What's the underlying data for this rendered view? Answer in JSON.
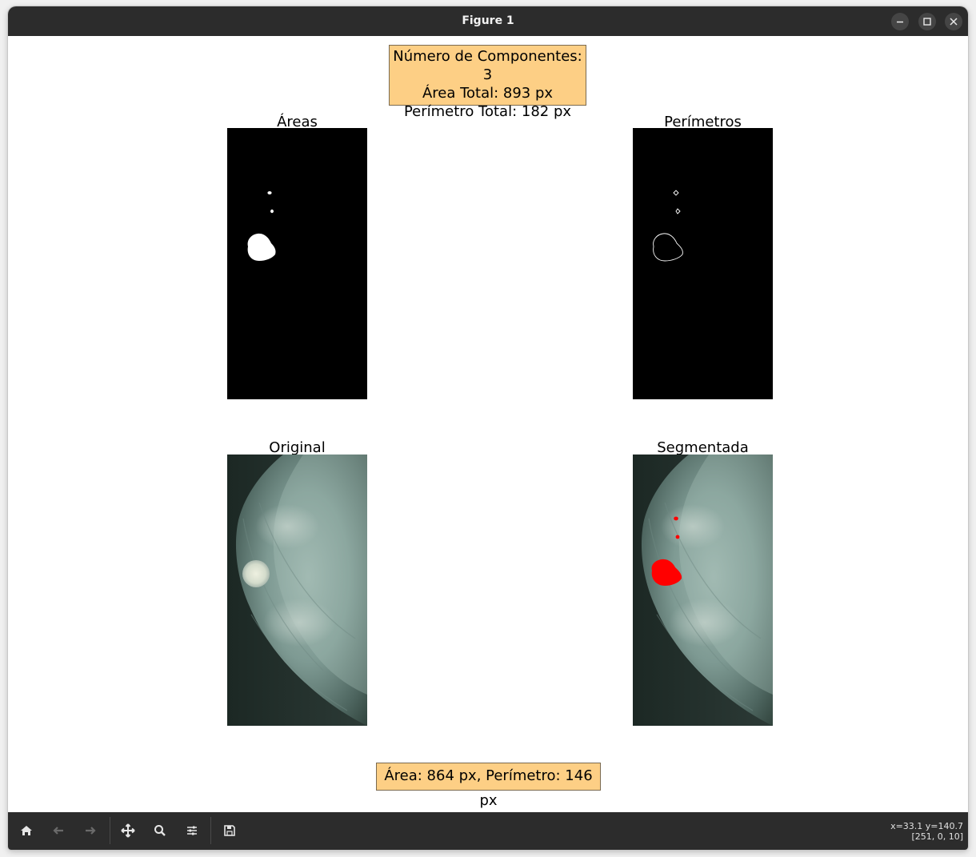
{
  "window": {
    "title": "Figure 1"
  },
  "stats_box": {
    "components": "Número de Componentes: 3",
    "area": "Área Total: 893 px",
    "perimeter": "Perímetro Total: 182 px"
  },
  "panels": {
    "areas": "Áreas",
    "perimeters": "Perímetros",
    "original": "Original",
    "segmented": "Segmentada"
  },
  "bottom_box": {
    "text": "Área: 864 px, Perímetro: 146 px"
  },
  "status": {
    "coords": "x=33.1 y=140.7",
    "pixel": "[251, 0, 10]"
  },
  "colors": {
    "info_box_bg": "#fdcf85",
    "segment_red": "#ff0000",
    "toolbar_bg": "#2c2c2c"
  },
  "toolbar": {
    "icons": [
      "home-icon",
      "back-icon",
      "forward-icon",
      "pan-icon",
      "zoom-icon",
      "configure-subplots-icon",
      "save-icon"
    ]
  }
}
